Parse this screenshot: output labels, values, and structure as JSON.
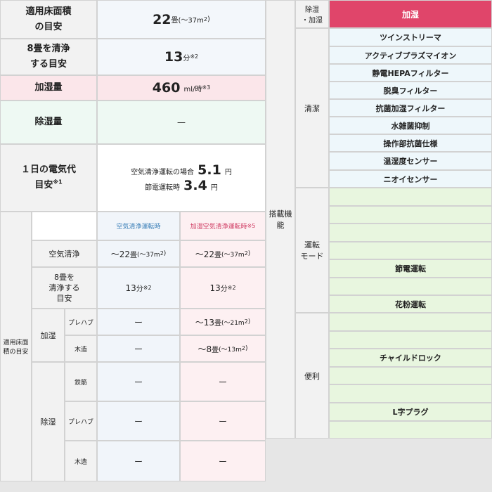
{
  "specs": {
    "floor_area": {
      "label_line1": "適用床面積",
      "label_line2": "の目安",
      "value": "22",
      "unit": "畳",
      "range": "(～37m",
      "sq": "2",
      "range_end": ")"
    },
    "clean8": {
      "label_line1": "8畳を清浄",
      "label_line2": "する目安",
      "value": "13",
      "unit": "分",
      "note": "※2"
    },
    "humid": {
      "label": "加湿量",
      "value": "460",
      "unit": "ml/時",
      "note": "※3"
    },
    "dehumid": {
      "label": "除湿量",
      "value": "—"
    },
    "power": {
      "label_line1": "１日の電気代",
      "label_line2": "目安",
      "note": "※1",
      "line1_text": "空気清浄運転の場合",
      "line1_value": "5.1",
      "line1_unit": "円",
      "line2_text": "節電運転時",
      "line2_value": "3.4",
      "line2_unit": "円"
    }
  },
  "area_table": {
    "side_label_line1": "適用床面",
    "side_label_line2": "積の目安",
    "col_air": "空気清浄運転時",
    "col_humid": "加湿空気清浄運転時",
    "col_humid_note": "※5",
    "row_air": {
      "label": "空気清浄",
      "air_prefix": "～22",
      "air_unit": "畳",
      "air_range": "(～37m",
      "air_sq": "2",
      "air_close": ")",
      "humid_prefix": "～22",
      "humid_unit": "畳",
      "humid_range": "(～37m",
      "humid_sq": "2",
      "humid_close": ")"
    },
    "row_clean": {
      "label_l1": "8畳を",
      "label_l2": "清浄する",
      "label_l3": "目安",
      "air_value": "13",
      "air_unit": "分",
      "air_note": "※2",
      "humid_value": "13",
      "humid_unit": "分",
      "humid_note": "※2"
    },
    "humidify": {
      "label": "加湿",
      "prefab": {
        "label": "プレハブ",
        "air": "ー",
        "humid_prefix": "～13",
        "humid_unit": "畳",
        "humid_range": "(～21m",
        "humid_sq": "2",
        "humid_close": ")"
      },
      "wood": {
        "label": "木造",
        "air": "ー",
        "humid_prefix": "～8",
        "humid_unit": "畳",
        "humid_range": "(～13m",
        "humid_sq": "2",
        "humid_close": ")"
      }
    },
    "dehumidify": {
      "label": "除湿",
      "rc": {
        "label": "鉄筋",
        "air": "ー",
        "humid": "ー"
      },
      "prefab": {
        "label": "プレハブ",
        "air": "ー",
        "humid": "ー"
      },
      "wood": {
        "label": "木造",
        "air": "ー",
        "humid": "ー"
      }
    }
  },
  "features": {
    "section_label_line1": "搭載機",
    "section_label_line2": "能",
    "header_label_line1": "除湿",
    "header_label_line2": "・加湿",
    "header_value": "加湿",
    "cleaning": {
      "label": "清潔",
      "items": [
        "ツインストリーマ",
        "アクティブプラズマイオン",
        "静電HEPAフィルター",
        "脱臭フィルター",
        "抗菌加湿フィルター",
        "水雑菌抑制",
        "操作部抗菌仕様",
        "温湿度センサー",
        "ニオイセンサー"
      ]
    },
    "modes": {
      "label_line1": "運転",
      "label_line2": "モード",
      "items": [
        "",
        "",
        "",
        "",
        "節電運転",
        "",
        "花粉運転"
      ]
    },
    "convenience": {
      "label": "便利",
      "items": [
        "",
        "",
        "チャイルドロック",
        "",
        "",
        "L字プラグ"
      ]
    }
  },
  "colors": {
    "accent": "#e0456a",
    "mode_bg": "#e8f6df",
    "feature_bg": "#eef7fb"
  }
}
